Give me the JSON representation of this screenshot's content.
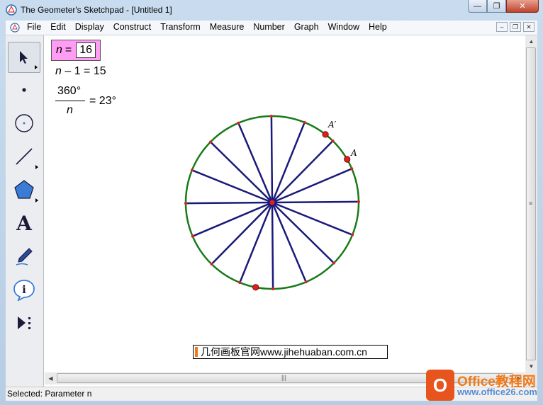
{
  "window": {
    "title": "The Geometer's Sketchpad - [Untitled 1]",
    "min_glyph": "—",
    "max_glyph": "❐",
    "close_glyph": "✕"
  },
  "menu": {
    "items": [
      "File",
      "Edit",
      "Display",
      "Construct",
      "Transform",
      "Measure",
      "Number",
      "Graph",
      "Window",
      "Help"
    ],
    "mdi_min": "–",
    "mdi_restore": "❐",
    "mdi_close": "✕"
  },
  "tools": [
    {
      "name": "arrow-select-tool",
      "icon": "arrow-cursor-icon",
      "active": true
    },
    {
      "name": "point-tool",
      "icon": "point-icon"
    },
    {
      "name": "compass-tool",
      "icon": "circle-icon"
    },
    {
      "name": "straightedge-tool",
      "icon": "line-segment-icon"
    },
    {
      "name": "polygon-tool",
      "icon": "pentagon-icon"
    },
    {
      "name": "text-tool",
      "icon": "letter-a-icon",
      "glyph": "A"
    },
    {
      "name": "marker-tool",
      "icon": "pen-icon"
    },
    {
      "name": "information-tool",
      "icon": "info-icon",
      "glyph": "i"
    },
    {
      "name": "custom-tool",
      "icon": "play-more-icon"
    }
  ],
  "sketch": {
    "parameter": {
      "name": "n",
      "eq": "=",
      "value": "16"
    },
    "calc1": {
      "lhs_var": "n",
      "lhs_rest": " – 1 = 15"
    },
    "calc2": {
      "numerator": "360°",
      "denominator": "n",
      "result": "= 23°"
    },
    "points": {
      "A": "A",
      "A_prime": "A′"
    },
    "colors": {
      "circle": "#1a7a1a",
      "spokes": "#1a1a7a",
      "points": "#e02020",
      "parameter_bg": "#ff9cf4"
    }
  },
  "watermark": "几何画板官网www.jihehuaban.com.cn",
  "office_logo": {
    "glyph": "O",
    "name": "Office教程网",
    "url": "www.office26.com"
  },
  "status": "Selected: Parameter n"
}
